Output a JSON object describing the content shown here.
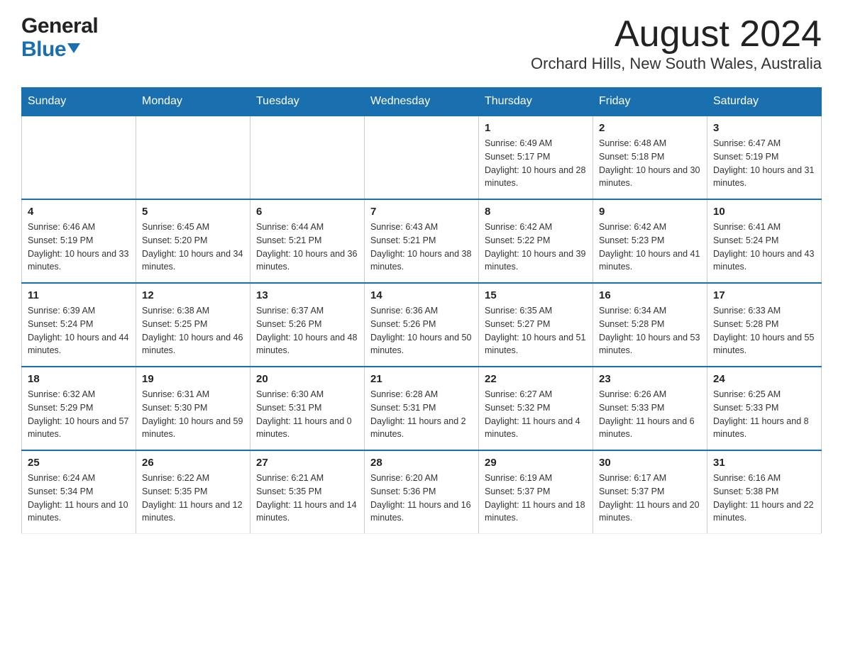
{
  "logo": {
    "general": "General",
    "blue": "Blue"
  },
  "header": {
    "month_year": "August 2024",
    "location": "Orchard Hills, New South Wales, Australia"
  },
  "days_of_week": [
    "Sunday",
    "Monday",
    "Tuesday",
    "Wednesday",
    "Thursday",
    "Friday",
    "Saturday"
  ],
  "weeks": [
    {
      "cells": [
        {
          "day": "",
          "info": ""
        },
        {
          "day": "",
          "info": ""
        },
        {
          "day": "",
          "info": ""
        },
        {
          "day": "",
          "info": ""
        },
        {
          "day": "1",
          "info": "Sunrise: 6:49 AM\nSunset: 5:17 PM\nDaylight: 10 hours and 28 minutes."
        },
        {
          "day": "2",
          "info": "Sunrise: 6:48 AM\nSunset: 5:18 PM\nDaylight: 10 hours and 30 minutes."
        },
        {
          "day": "3",
          "info": "Sunrise: 6:47 AM\nSunset: 5:19 PM\nDaylight: 10 hours and 31 minutes."
        }
      ]
    },
    {
      "cells": [
        {
          "day": "4",
          "info": "Sunrise: 6:46 AM\nSunset: 5:19 PM\nDaylight: 10 hours and 33 minutes."
        },
        {
          "day": "5",
          "info": "Sunrise: 6:45 AM\nSunset: 5:20 PM\nDaylight: 10 hours and 34 minutes."
        },
        {
          "day": "6",
          "info": "Sunrise: 6:44 AM\nSunset: 5:21 PM\nDaylight: 10 hours and 36 minutes."
        },
        {
          "day": "7",
          "info": "Sunrise: 6:43 AM\nSunset: 5:21 PM\nDaylight: 10 hours and 38 minutes."
        },
        {
          "day": "8",
          "info": "Sunrise: 6:42 AM\nSunset: 5:22 PM\nDaylight: 10 hours and 39 minutes."
        },
        {
          "day": "9",
          "info": "Sunrise: 6:42 AM\nSunset: 5:23 PM\nDaylight: 10 hours and 41 minutes."
        },
        {
          "day": "10",
          "info": "Sunrise: 6:41 AM\nSunset: 5:24 PM\nDaylight: 10 hours and 43 minutes."
        }
      ]
    },
    {
      "cells": [
        {
          "day": "11",
          "info": "Sunrise: 6:39 AM\nSunset: 5:24 PM\nDaylight: 10 hours and 44 minutes."
        },
        {
          "day": "12",
          "info": "Sunrise: 6:38 AM\nSunset: 5:25 PM\nDaylight: 10 hours and 46 minutes."
        },
        {
          "day": "13",
          "info": "Sunrise: 6:37 AM\nSunset: 5:26 PM\nDaylight: 10 hours and 48 minutes."
        },
        {
          "day": "14",
          "info": "Sunrise: 6:36 AM\nSunset: 5:26 PM\nDaylight: 10 hours and 50 minutes."
        },
        {
          "day": "15",
          "info": "Sunrise: 6:35 AM\nSunset: 5:27 PM\nDaylight: 10 hours and 51 minutes."
        },
        {
          "day": "16",
          "info": "Sunrise: 6:34 AM\nSunset: 5:28 PM\nDaylight: 10 hours and 53 minutes."
        },
        {
          "day": "17",
          "info": "Sunrise: 6:33 AM\nSunset: 5:28 PM\nDaylight: 10 hours and 55 minutes."
        }
      ]
    },
    {
      "cells": [
        {
          "day": "18",
          "info": "Sunrise: 6:32 AM\nSunset: 5:29 PM\nDaylight: 10 hours and 57 minutes."
        },
        {
          "day": "19",
          "info": "Sunrise: 6:31 AM\nSunset: 5:30 PM\nDaylight: 10 hours and 59 minutes."
        },
        {
          "day": "20",
          "info": "Sunrise: 6:30 AM\nSunset: 5:31 PM\nDaylight: 11 hours and 0 minutes."
        },
        {
          "day": "21",
          "info": "Sunrise: 6:28 AM\nSunset: 5:31 PM\nDaylight: 11 hours and 2 minutes."
        },
        {
          "day": "22",
          "info": "Sunrise: 6:27 AM\nSunset: 5:32 PM\nDaylight: 11 hours and 4 minutes."
        },
        {
          "day": "23",
          "info": "Sunrise: 6:26 AM\nSunset: 5:33 PM\nDaylight: 11 hours and 6 minutes."
        },
        {
          "day": "24",
          "info": "Sunrise: 6:25 AM\nSunset: 5:33 PM\nDaylight: 11 hours and 8 minutes."
        }
      ]
    },
    {
      "cells": [
        {
          "day": "25",
          "info": "Sunrise: 6:24 AM\nSunset: 5:34 PM\nDaylight: 11 hours and 10 minutes."
        },
        {
          "day": "26",
          "info": "Sunrise: 6:22 AM\nSunset: 5:35 PM\nDaylight: 11 hours and 12 minutes."
        },
        {
          "day": "27",
          "info": "Sunrise: 6:21 AM\nSunset: 5:35 PM\nDaylight: 11 hours and 14 minutes."
        },
        {
          "day": "28",
          "info": "Sunrise: 6:20 AM\nSunset: 5:36 PM\nDaylight: 11 hours and 16 minutes."
        },
        {
          "day": "29",
          "info": "Sunrise: 6:19 AM\nSunset: 5:37 PM\nDaylight: 11 hours and 18 minutes."
        },
        {
          "day": "30",
          "info": "Sunrise: 6:17 AM\nSunset: 5:37 PM\nDaylight: 11 hours and 20 minutes."
        },
        {
          "day": "31",
          "info": "Sunrise: 6:16 AM\nSunset: 5:38 PM\nDaylight: 11 hours and 22 minutes."
        }
      ]
    }
  ]
}
